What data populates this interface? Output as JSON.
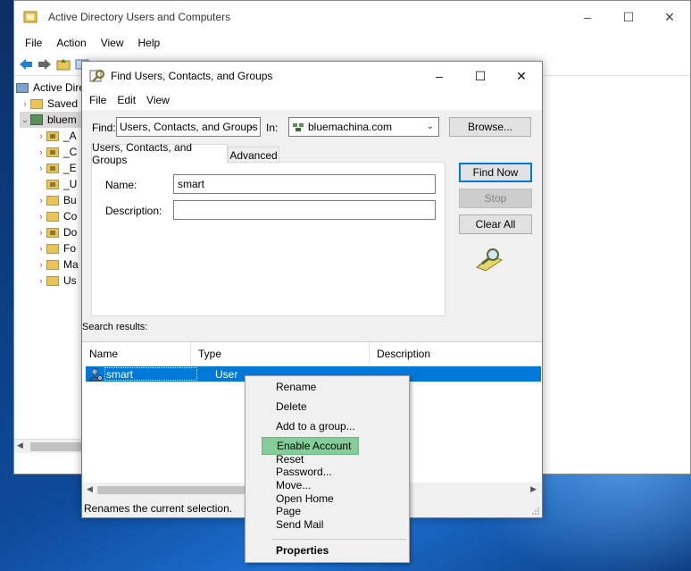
{
  "main_window": {
    "title": "Active Directory Users and Computers",
    "controls": {
      "minimize": "–",
      "maximize": "☐",
      "close": "✕"
    },
    "menu": [
      "File",
      "Action",
      "View",
      "Help"
    ],
    "tree": [
      {
        "label": "Active Directory",
        "expander": ""
      },
      {
        "label": "Saved",
        "expander": "›"
      },
      {
        "label": "bluem",
        "expander": "⌄"
      },
      {
        "label": "_A",
        "expander": "›"
      },
      {
        "label": "_C",
        "expander": "›"
      },
      {
        "label": "_E",
        "expander": "›"
      },
      {
        "label": "_U",
        "expander": ""
      },
      {
        "label": "Bu",
        "expander": "›"
      },
      {
        "label": "Co",
        "expander": "›"
      },
      {
        "label": "Do",
        "expander": "›"
      },
      {
        "label": "Fo",
        "expander": "›"
      },
      {
        "label": "Ma",
        "expander": "›"
      },
      {
        "label": "Us",
        "expander": "›"
      }
    ]
  },
  "dialog": {
    "title": "Find Users, Contacts, and Groups",
    "controls": {
      "minimize": "–",
      "maximize": "☐",
      "close": "✕"
    },
    "menu": [
      "File",
      "Edit",
      "View"
    ],
    "find_label": "Find:",
    "find_value": "Users, Contacts, and Groups",
    "in_label": "In:",
    "in_value": "bluemachina.com",
    "browse": "Browse...",
    "tabs": [
      "Users, Contacts, and Groups",
      "Advanced"
    ],
    "name_label": "Name:",
    "name_value": "smart",
    "description_label": "Description:",
    "description_value": "",
    "buttons": {
      "find_now": "Find Now",
      "stop": "Stop",
      "clear_all": "Clear All"
    },
    "results_label": "Search results:",
    "columns": [
      "Name",
      "Type",
      "Description"
    ],
    "rows": [
      {
        "name": "smart",
        "type": "User",
        "description": ""
      }
    ],
    "status": "Renames the current selection."
  },
  "context_menu": {
    "items": [
      "Rename",
      "Delete",
      "Add to a group...",
      "Enable Account",
      "Reset Password...",
      "Move...",
      "Open Home Page",
      "Send Mail"
    ],
    "highlighted": "Enable Account",
    "default_item": "Properties"
  },
  "colors": {
    "selection": "#0078d7",
    "menu_highlight": "#84cc98",
    "folder": "#e8c45a"
  }
}
